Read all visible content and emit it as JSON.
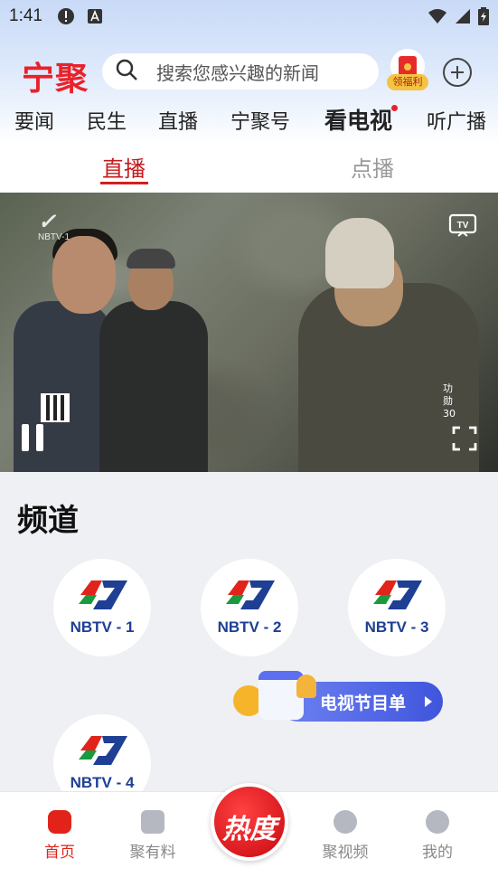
{
  "status_bar": {
    "time": "1:41"
  },
  "header": {
    "logo_text": "宁聚",
    "search": {
      "placeholder": "搜索您感兴趣的新闻"
    },
    "gift_label": "领福利"
  },
  "nav_tabs": [
    {
      "label": "要闻"
    },
    {
      "label": "民生"
    },
    {
      "label": "直播"
    },
    {
      "label": "宁聚号"
    },
    {
      "label": "看电视",
      "active": true
    },
    {
      "label": "听广播"
    }
  ],
  "sub_tabs": [
    {
      "label": "直播",
      "active": true
    },
    {
      "label": "点播",
      "active": false
    }
  ],
  "video": {
    "watermark_channel": "NBTV-1",
    "side_text": "功勋30"
  },
  "channels": {
    "title": "频道",
    "items": [
      {
        "name": "NBTV - 1"
      },
      {
        "name": "NBTV - 2"
      },
      {
        "name": "NBTV - 3"
      },
      {
        "name": "NBTV - 4"
      }
    ],
    "guide_label": "电视节目单"
  },
  "bottom_nav": {
    "items": [
      {
        "label": "首页",
        "icon": "home-icon",
        "active": true
      },
      {
        "label": "聚有料",
        "icon": "bolt-box-icon"
      },
      {
        "label": "聚视频",
        "icon": "play-icon"
      },
      {
        "label": "我的",
        "icon": "smile-icon"
      }
    ],
    "hot_label": "热度"
  },
  "colors": {
    "accent_red": "#e2231a",
    "channel_blue": "#1e3f94",
    "guide_blue": "#3f55dc"
  }
}
